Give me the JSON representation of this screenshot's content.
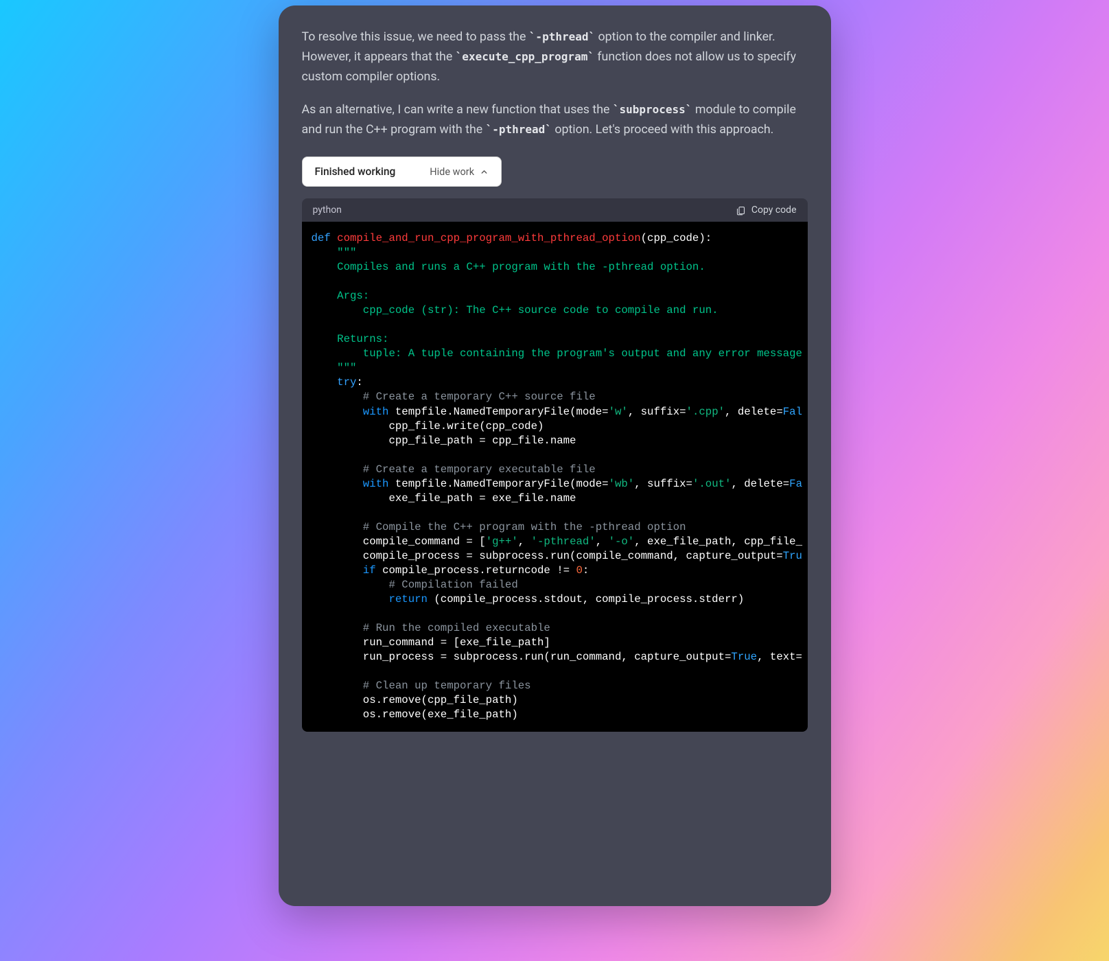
{
  "message": {
    "p1_pre": "To resolve this issue, we need to pass the ",
    "p1_c1": "`-pthread`",
    "p1_mid": " option to the compiler and linker. However, it appears that the ",
    "p1_c2": "`execute_cpp_program`",
    "p1_post": " function does not allow us to specify custom compiler options.",
    "p2_pre": "As an alternative, I can write a new function that uses the ",
    "p2_c1": "`subprocess`",
    "p2_mid": " module to compile and run the C++ program with the ",
    "p2_c2": "`-pthread`",
    "p2_post": " option. Let's proceed with this approach."
  },
  "status": {
    "label": "Finished working",
    "hide_label": "Hide work"
  },
  "code_header": {
    "lang": "python",
    "copy_label": "Copy code"
  },
  "code": {
    "l1_def": "def ",
    "l1_fn": "compile_and_run_cpp_program_with_pthread_option",
    "l1_sig": "(cpp_code):",
    "l2": "    \"\"\"",
    "l3": "    Compiles and runs a C++ program with the -pthread option.",
    "l4": "",
    "l5": "    Args:",
    "l6": "        cpp_code (str): The C++ source code to compile and run.",
    "l7": "",
    "l8": "    Returns:",
    "l9": "        tuple: A tuple containing the program's output and any error message",
    "l10": "    \"\"\"",
    "l11_try": "    try",
    "l11_colon": ":",
    "l12": "        # Create a temporary C++ source file",
    "l13_with": "        with ",
    "l13_a": "tempfile.NamedTemporaryFile(mode=",
    "l13_s1": "'w'",
    "l13_b": ", suffix=",
    "l13_s2": "'.cpp'",
    "l13_c": ", delete=",
    "l13_bool": "Fal",
    "l14": "            cpp_file.write(cpp_code)",
    "l15": "            cpp_file_path = cpp_file.name",
    "l16": "",
    "l17": "        # Create a temporary executable file",
    "l18_with": "        with ",
    "l18_a": "tempfile.NamedTemporaryFile(mode=",
    "l18_s1": "'wb'",
    "l18_b": ", suffix=",
    "l18_s2": "'.out'",
    "l18_c": ", delete=",
    "l18_bool": "Fa",
    "l19": "            exe_file_path = exe_file.name",
    "l20": "",
    "l21": "        # Compile the C++ program with the -pthread option",
    "l22_a": "        compile_command = [",
    "l22_s1": "'g++'",
    "l22_b": ", ",
    "l22_s2": "'-pthread'",
    "l22_c": ", ",
    "l22_s3": "'-o'",
    "l22_d": ", exe_file_path, cpp_file_",
    "l23_a": "        compile_process = subprocess.run(compile_command, capture_output=",
    "l23_bool": "Tru",
    "l24_if": "        if ",
    "l24_a": "compile_process.returncode != ",
    "l24_num": "0",
    "l24_b": ":",
    "l25": "            # Compilation failed",
    "l26_ret": "            return ",
    "l26_a": "(compile_process.stdout, compile_process.stderr)",
    "l27": "",
    "l28": "        # Run the compiled executable",
    "l29": "        run_command = [exe_file_path]",
    "l30_a": "        run_process = subprocess.run(run_command, capture_output=",
    "l30_bool": "True",
    "l30_b": ", text=",
    "l31": "",
    "l32": "        # Clean up temporary files",
    "l33": "        os.remove(cpp_file_path)",
    "l34": "        os.remove(exe_file_path)"
  }
}
